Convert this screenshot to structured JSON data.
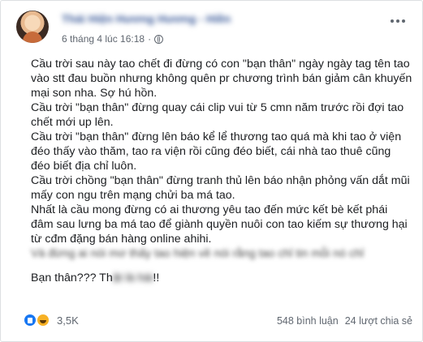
{
  "post": {
    "author_name": "Thái Hiện Hương Hương - Hiền",
    "timestamp": "6 tháng 4 lúc 16:18",
    "privacy_separator": "·",
    "paragraphs": [
      "Cầu trời sau này tao chết đi đừng có con \"bạn thân\" ngày ngày tag tên tao vào stt đau buồn nhưng không quên pr chương trình bán giảm cân khuyến mại son nha. Sợ hú hồn.",
      "Cầu trời \"bạn thân\" đừng quay cái clip vui từ 5 cmn năm trước rồi đợi tao chết mới up lên.",
      "Cầu trời \"bạn thân\" đừng lên báo kể lể thương tao quá mà khi tao ở viện đéo thấy vào thăm, tao ra viện rồi cũng đéo biết, cái nhà tao thuê cũng đéo biết địa chỉ luôn.",
      "Cầu trời chồng \"bạn thân\" đừng tranh thủ lên báo nhận phỏng vấn dắt mũi mấy con ngu trên mạng chửi ba má tao.",
      "Nhất là cầu mong đừng có ai thương yêu tao đến mức kết bè kết phái đâm sau lưng ba má tao để giành quyền nuôi con tao kiếm sự thương hại từ cđm đặng bán hàng online ahihi."
    ],
    "blurred_line": "Và đừng ai nói mơ thấy tao hiện về nói rằng tao chỉ tin mỗi nó chỉ",
    "last_line_visible_start": "Bạn thân??? Th",
    "last_line_blurred": "ật là hài",
    "last_line_visible_end": "!!"
  },
  "footer": {
    "reaction_count": "3,5K",
    "comments": "548 bình luận",
    "shares": "24 lượt chia sẻ"
  },
  "icons": {
    "globe": "globe-icon",
    "more": "more-options-icon",
    "like": "like-reaction-icon",
    "haha": "haha-reaction-icon"
  }
}
